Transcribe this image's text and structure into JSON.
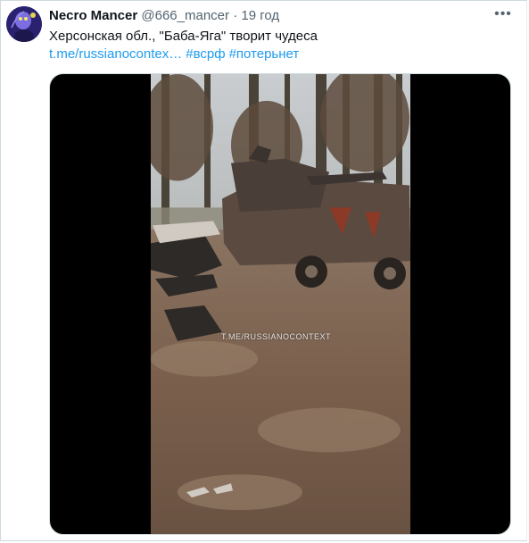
{
  "tweet": {
    "author_name": "Necro Mancer",
    "handle": "@666_mancer",
    "separator": "·",
    "time": "19 год",
    "more_label": "•••",
    "text": "Херсонская обл., \"Баба-Яга\" творит чудеса",
    "link": "t.me/russianocontex…",
    "hashtags": [
      "#всрф",
      "#потерьнет"
    ]
  },
  "media": {
    "watermark": "T.ME/RUSSIANOCONTEXT"
  },
  "colors": {
    "link": "#1d9bf0",
    "secondary_text": "#536471",
    "border": "#cfd9de"
  },
  "icons": {
    "more": "more-horizontal-icon"
  }
}
